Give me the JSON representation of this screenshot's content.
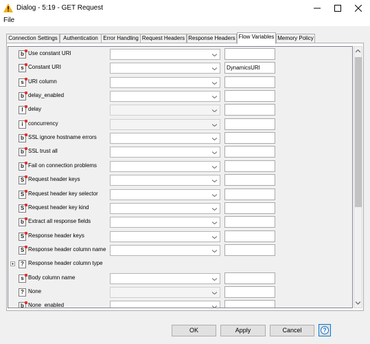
{
  "window": {
    "title": "Dialog - 5:19 - GET Request"
  },
  "menu": {
    "file": "File"
  },
  "tabs": [
    {
      "label": "Connection Settings",
      "active": false
    },
    {
      "label": "Authentication",
      "active": false
    },
    {
      "label": "Error Handling",
      "active": false
    },
    {
      "label": "Request Headers",
      "active": false
    },
    {
      "label": "Response Headers",
      "active": false
    },
    {
      "label": "Flow Variables",
      "active": true
    },
    {
      "label": "Memory Policy",
      "active": false
    }
  ],
  "rows": [
    {
      "label": "Use constant URI",
      "type_letter": "b",
      "expandable": false,
      "combo_enabled": true,
      "has_combo": true,
      "field_value": ""
    },
    {
      "label": "Constant URI",
      "type_letter": "s",
      "expandable": false,
      "combo_enabled": true,
      "has_combo": true,
      "field_value": "DynamicsURI"
    },
    {
      "label": "URI column",
      "type_letter": "s",
      "expandable": false,
      "combo_enabled": true,
      "has_combo": true,
      "field_value": ""
    },
    {
      "label": "delay_enabled",
      "type_letter": "b",
      "expandable": false,
      "combo_enabled": true,
      "has_combo": true,
      "field_value": ""
    },
    {
      "label": "delay",
      "type_letter": "l",
      "expandable": false,
      "combo_enabled": false,
      "has_combo": true,
      "field_value": ""
    },
    {
      "label": "concurrency",
      "type_letter": "i",
      "expandable": false,
      "combo_enabled": false,
      "has_combo": true,
      "field_value": ""
    },
    {
      "label": "SSL ignore hostname errors",
      "type_letter": "b",
      "expandable": false,
      "combo_enabled": true,
      "has_combo": true,
      "field_value": ""
    },
    {
      "label": "SSL trust all",
      "type_letter": "b",
      "expandable": false,
      "combo_enabled": true,
      "has_combo": true,
      "field_value": ""
    },
    {
      "label": "Fail on connection problems",
      "type_letter": "b",
      "expandable": false,
      "combo_enabled": true,
      "has_combo": true,
      "field_value": ""
    },
    {
      "label": "Request header keys",
      "type_letter": "S",
      "expandable": false,
      "combo_enabled": true,
      "has_combo": true,
      "field_value": ""
    },
    {
      "label": "Request header key selector",
      "type_letter": "S",
      "expandable": false,
      "combo_enabled": true,
      "has_combo": true,
      "field_value": ""
    },
    {
      "label": "Request header key kind",
      "type_letter": "S",
      "expandable": false,
      "combo_enabled": true,
      "has_combo": true,
      "field_value": ""
    },
    {
      "label": "Extract all response fields",
      "type_letter": "b",
      "expandable": false,
      "combo_enabled": true,
      "has_combo": true,
      "field_value": ""
    },
    {
      "label": "Response header keys",
      "type_letter": "S",
      "expandable": false,
      "combo_enabled": true,
      "has_combo": true,
      "field_value": ""
    },
    {
      "label": "Response header column name",
      "type_letter": "S",
      "expandable": false,
      "combo_enabled": true,
      "has_combo": true,
      "field_value": ""
    },
    {
      "label": "Response header column type",
      "type_letter": "?",
      "expandable": true,
      "combo_enabled": true,
      "has_combo": false,
      "field_value": ""
    },
    {
      "label": "Body column name",
      "type_letter": "s",
      "expandable": false,
      "combo_enabled": true,
      "has_combo": true,
      "field_value": ""
    },
    {
      "label": "None",
      "type_letter": "?",
      "expandable": false,
      "combo_enabled": false,
      "has_combo": true,
      "field_value": ""
    },
    {
      "label": "None_enabled",
      "type_letter": "b",
      "expandable": false,
      "combo_enabled": true,
      "has_combo": true,
      "field_value": ""
    }
  ],
  "buttons": {
    "ok": "OK",
    "apply": "Apply",
    "cancel": "Cancel",
    "help": "?"
  },
  "colors": {
    "accent": "#0078d7",
    "warning": "#f2b01e",
    "type_marker": "#e0302d"
  }
}
